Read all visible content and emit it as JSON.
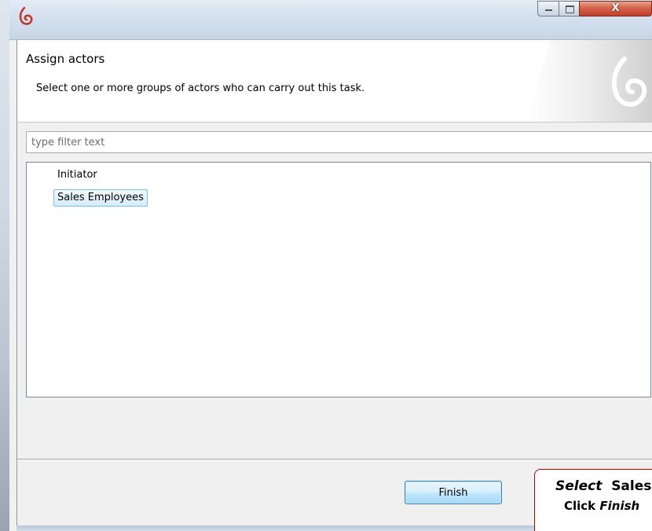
{
  "window": {
    "app_icon": "bonita-logo-icon",
    "controls": {
      "minimize_icon": "minimize-icon",
      "maximize_icon": "maximize-icon",
      "close_label": "X",
      "close_icon": "close-icon"
    }
  },
  "header": {
    "title": "Assign actors",
    "message": "Select one or more groups of actors who can carry out this task.",
    "banner_icon": "bonita-watermark-icon"
  },
  "filter": {
    "placeholder": "type filter text",
    "value": ""
  },
  "actors": {
    "items": [
      {
        "label": "Initiator",
        "selected": false
      },
      {
        "label": "Sales Employees",
        "selected": true
      }
    ]
  },
  "footer": {
    "finish_label": "Finish"
  },
  "callout": {
    "line1_verb": "Select",
    "line1_rest": "Sales",
    "line2_prefix": "Click",
    "line2_action": "Finish"
  },
  "colors": {
    "selection_fill": "#d6ecfb",
    "selection_border": "#7dc2ee",
    "close_button": "#c0402a",
    "callout_border": "#c00000",
    "bonita_red": "#c0392b"
  }
}
